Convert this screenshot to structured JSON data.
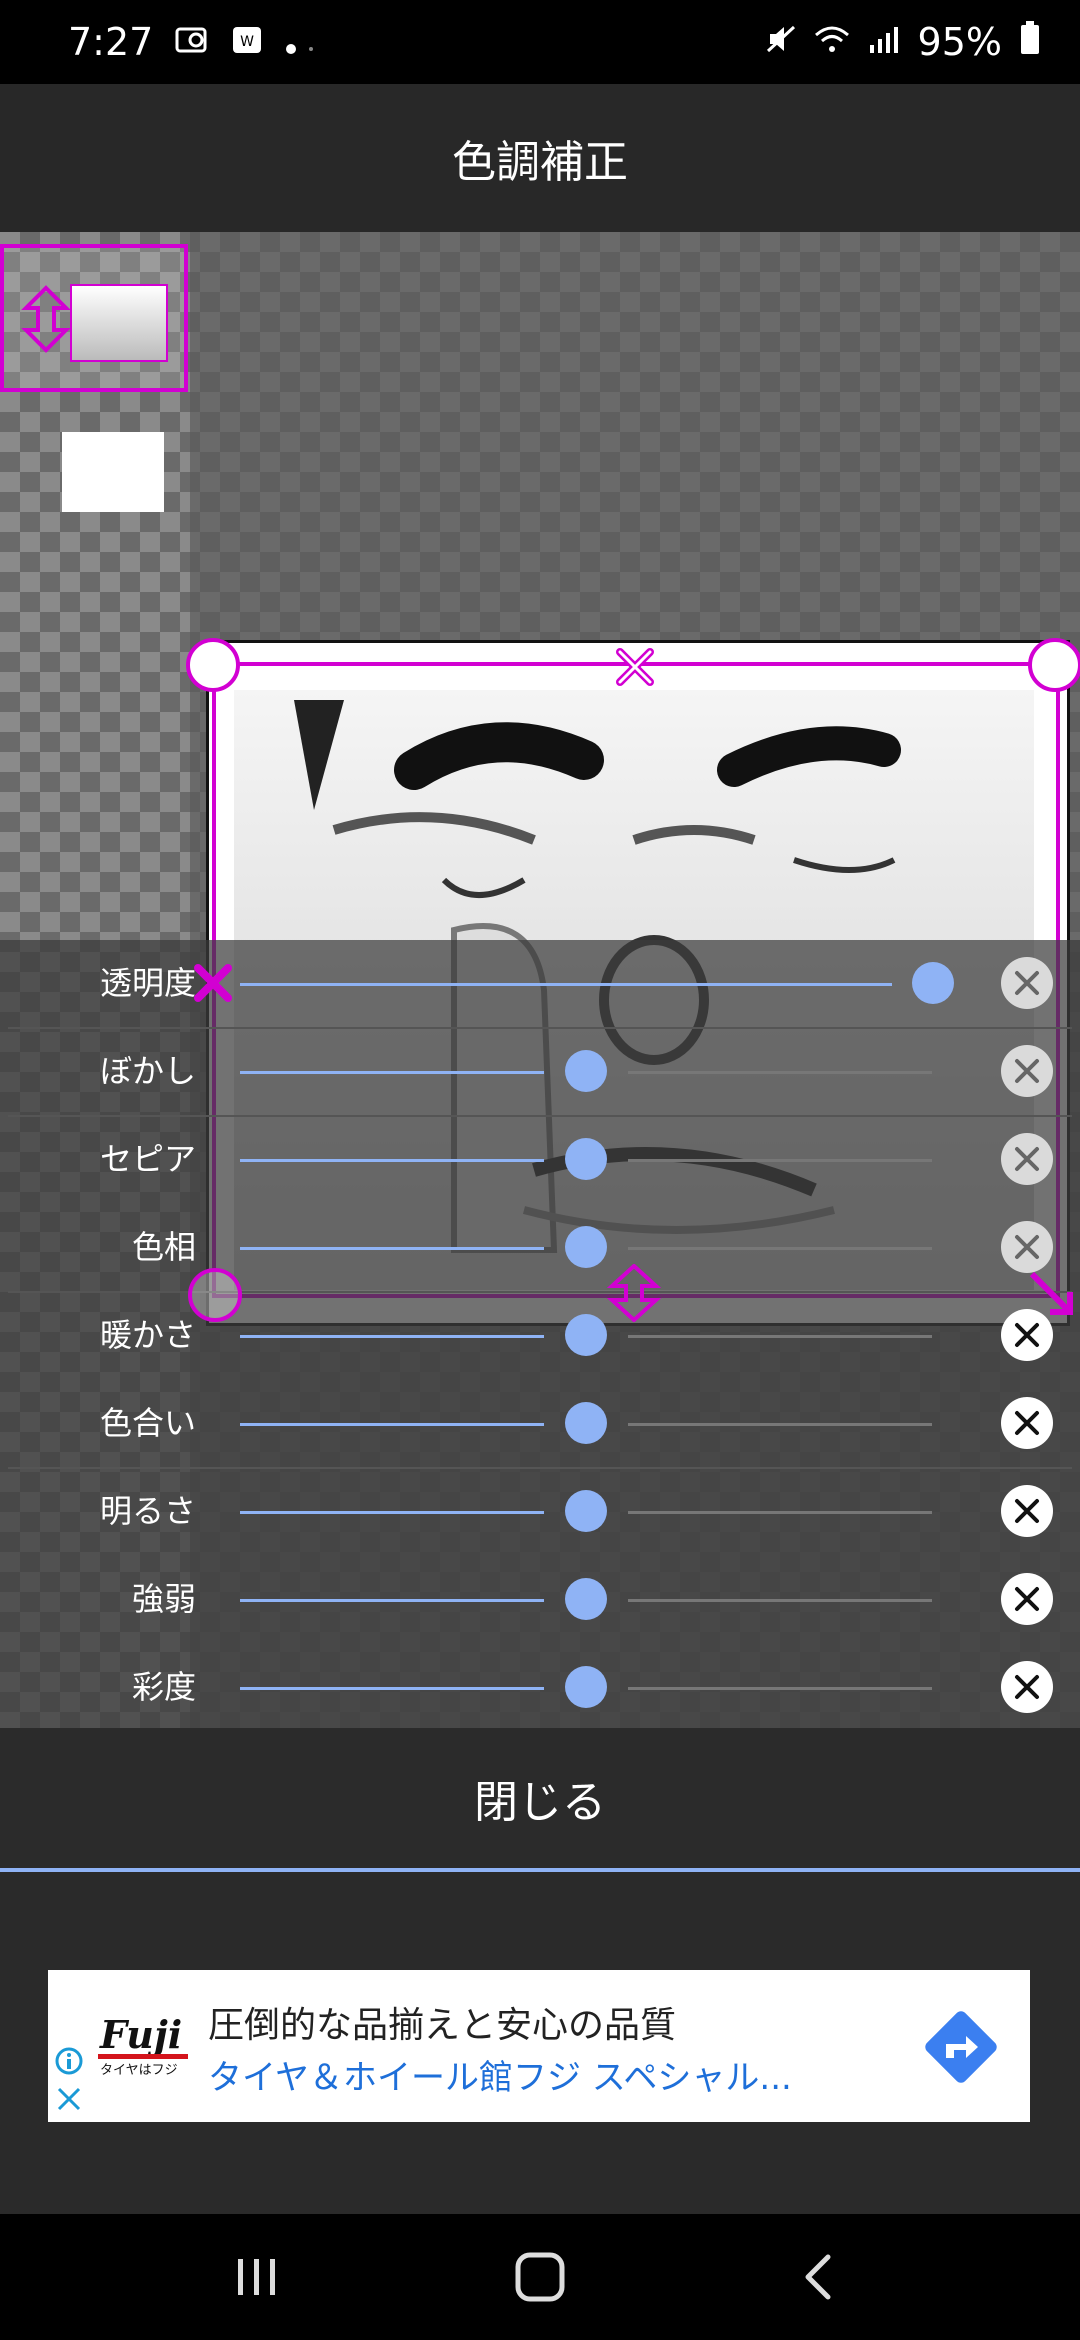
{
  "status": {
    "time": "7:27",
    "battery": "95%"
  },
  "header": {
    "title": "色調補正"
  },
  "adjustments": [
    {
      "label": "透明度",
      "value": 1.0
    },
    {
      "label": "ぼかし",
      "value": 0.5
    },
    {
      "label": "セピア",
      "value": 0.5
    },
    {
      "label": "色相",
      "value": 0.5
    },
    {
      "label": "暖かさ",
      "value": 0.5
    },
    {
      "label": "色合い",
      "value": 0.5
    },
    {
      "label": "明るさ",
      "value": 0.5
    },
    {
      "label": "強弱",
      "value": 0.5
    },
    {
      "label": "彩度",
      "value": 0.5
    }
  ],
  "footer": {
    "close_label": "閉じる"
  },
  "ad": {
    "headline": "圧倒的な品揃えと安心の品質",
    "subline": "タイヤ＆ホイール館フジ スペシャル...",
    "brand": "Fuji",
    "brand_sub": "タイヤはフジ"
  },
  "colors": {
    "accent": "#8fb3f5",
    "selection": "#d200d2",
    "ad_link": "#1e6fd9"
  }
}
